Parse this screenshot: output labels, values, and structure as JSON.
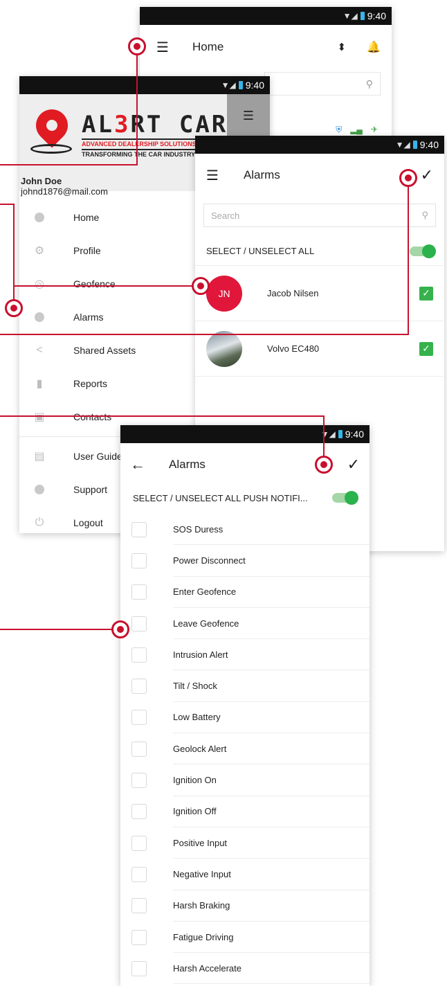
{
  "statusbar": {
    "time": "9:40"
  },
  "home": {
    "title": "Home",
    "menu_icon": "hamburger-icon",
    "sort_icon": "sort-icon",
    "bell_icon": "bell-icon"
  },
  "drawer": {
    "brand": {
      "prefix": "AL",
      "three": "3",
      "suffix": "RT CAR",
      "tag1": "ADVANCED DEALERSHIP SOLUTIONS",
      "tag2": "TRANSFORMING THE CAR INDUSTRY"
    },
    "user_name": "John Doe",
    "user_email": "johnd1876@mail.com",
    "items": [
      {
        "label": "Home",
        "icon": "home-icon"
      },
      {
        "label": "Profile",
        "icon": "gear-icon"
      },
      {
        "label": "Geofence",
        "icon": "target-icon"
      },
      {
        "label": "Alarms",
        "icon": "alarm-icon"
      },
      {
        "label": "Shared Assets",
        "icon": "share-icon"
      },
      {
        "label": "Reports",
        "icon": "bar-chart-icon"
      },
      {
        "label": "Contacts",
        "icon": "contact-icon"
      },
      {
        "label": "User Guide",
        "icon": "document-icon"
      },
      {
        "label": "Support",
        "icon": "info-icon"
      },
      {
        "label": "Logout",
        "icon": "power-icon"
      }
    ]
  },
  "alarms_list": {
    "title": "Alarms",
    "search_placeholder": "Search",
    "select_all": "SELECT / UNSELECT ALL",
    "rows": [
      {
        "initials": "JN",
        "name": "Jacob Nilsen",
        "checked": true
      },
      {
        "initials": "",
        "name": "Volvo EC480",
        "checked": true
      }
    ]
  },
  "alarms_push": {
    "title": "Alarms",
    "select_all": "SELECT / UNSELECT ALL PUSH NOTIFI...",
    "items": [
      "SOS Duress",
      "Power Disconnect",
      "Enter Geofence",
      "Leave Geofence",
      "Intrusion Alert",
      "Tilt / Shock",
      "Low Battery",
      "Geolock Alert",
      "Ignition On",
      "Ignition Off",
      "Positive Input",
      "Negative Input",
      "Harsh Braking",
      "Fatigue Driving",
      "Harsh Accelerate"
    ]
  },
  "colors": {
    "accent": "#c8102e",
    "toggle": "#2bb24c",
    "avatar": "#e0173a"
  }
}
